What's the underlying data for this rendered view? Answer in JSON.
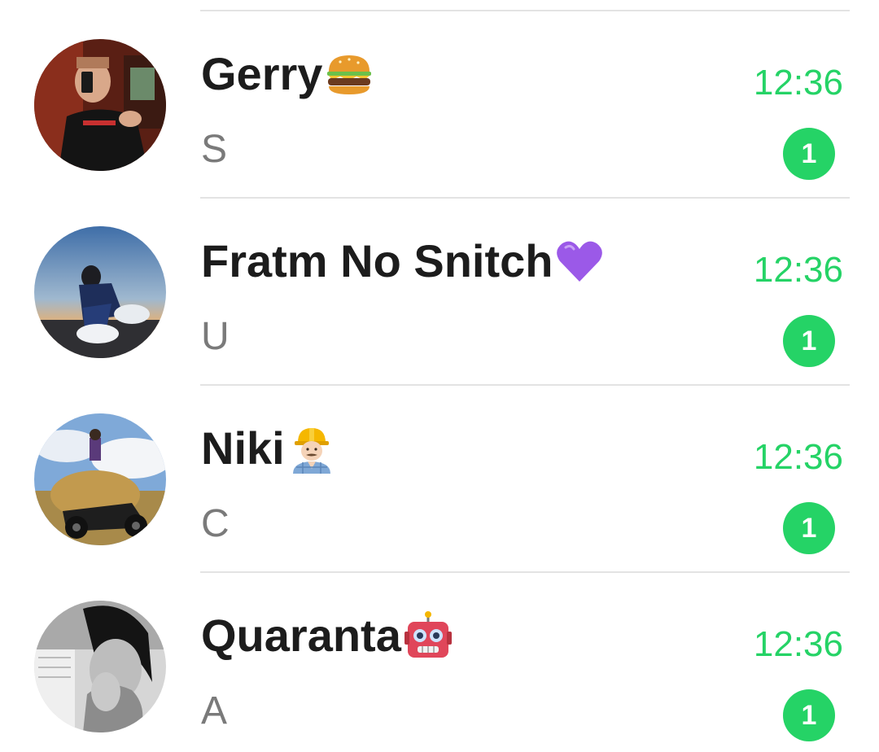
{
  "chats": [
    {
      "name": "Gerry",
      "emoji": "hamburger-emoji",
      "preview": "S",
      "time": "12:36",
      "unread": "1"
    },
    {
      "name": "Fratm No Snitch",
      "emoji": "purple-heart-emoji",
      "preview": "U",
      "time": "12:36",
      "unread": "1"
    },
    {
      "name": "Niki",
      "emoji": "construction-worker-emoji",
      "preview": "C",
      "time": "12:36",
      "unread": "1"
    },
    {
      "name": "Quaranta",
      "emoji": "robot-emoji",
      "preview": "A",
      "time": "12:36",
      "unread": "1"
    }
  ],
  "colors": {
    "accent": "#25d366",
    "name_text": "#1c1c1c",
    "preview_text": "#7a7a7a",
    "divider": "#e3e3e3"
  }
}
